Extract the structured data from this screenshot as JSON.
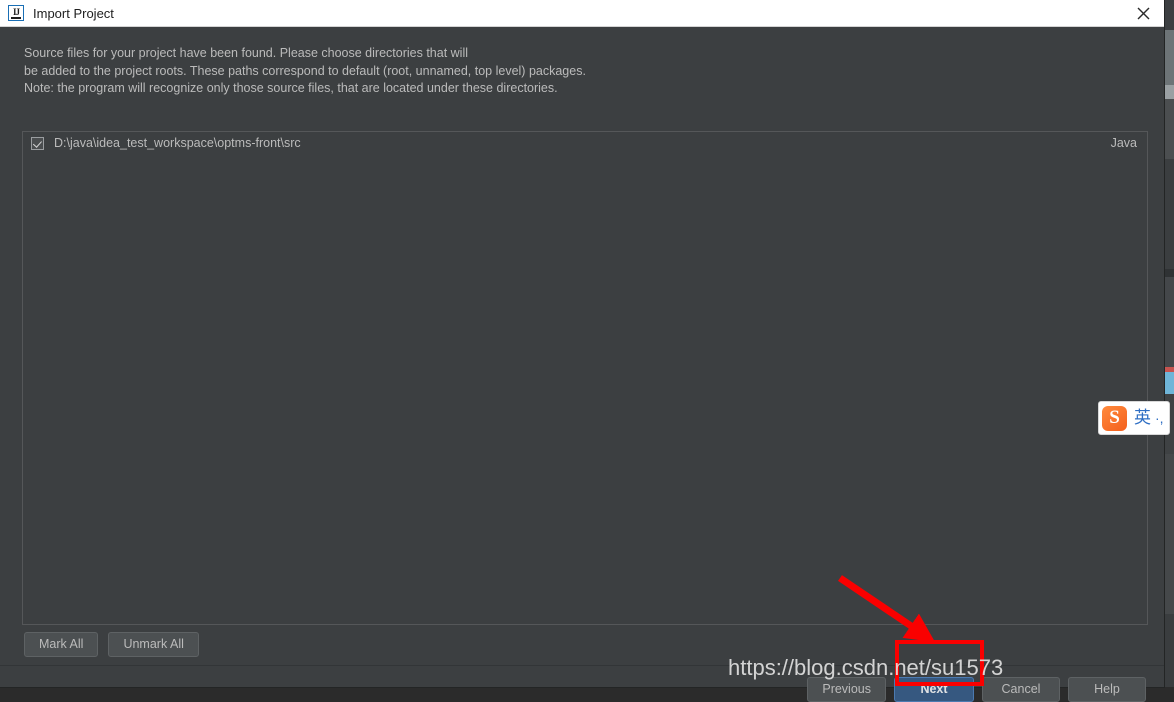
{
  "window": {
    "title": "Import Project",
    "icon": "intellij-idea-icon",
    "close_label": "✕"
  },
  "description": {
    "lines": [
      "Source files for your project have been found. Please choose directories that will",
      "be added to the project roots. These paths correspond to default (root, unnamed, top level) packages.",
      "Note: the program will recognize only those source files, that are located under these directories."
    ]
  },
  "source_list": {
    "rows": [
      {
        "checked": true,
        "path": "D:\\java\\idea_test_workspace\\optms-front\\src",
        "type": "Java"
      }
    ]
  },
  "mark_buttons": {
    "mark_all": "Mark All",
    "unmark_all": "Unmark All"
  },
  "footer": {
    "previous": "Previous",
    "next": "Next",
    "cancel": "Cancel",
    "help": "Help"
  },
  "annotations": {
    "watermark": "https://blog.csdn.net/su1573",
    "highlight_color": "#fa0000",
    "arrow_color": "#fa0000"
  },
  "ime": {
    "logo": "sogou-logo-icon",
    "logo_letter": "S",
    "mode": "英",
    "dots": "·,"
  },
  "colors": {
    "dialog_bg": "#3c3f41",
    "title_bg": "#ffffff",
    "text": "#bbbbbb",
    "primary_button": "#365880",
    "button_bg": "#4c5052",
    "border": "#555759"
  }
}
